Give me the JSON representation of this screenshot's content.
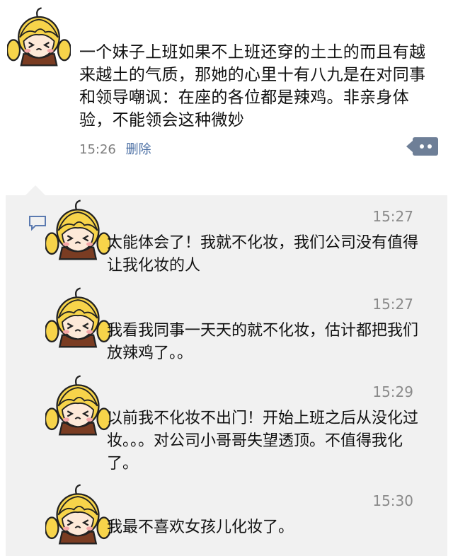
{
  "post": {
    "text": "一个妹子上班如果不上班还穿的土土的而且有越来越土的气质，那她的心里十有八九是在对同事和领导嘲讽：在座的各位都是辣鸡。非亲身体验，不能领会这种微妙",
    "time": "15:26",
    "delete_label": "删除"
  },
  "comments": [
    {
      "time": "15:27",
      "text": "太能体会了！我就不化妆，我们公司没有值得让我化妆的人"
    },
    {
      "time": "15:27",
      "text": "我看我同事一天天的就不化妆，估计都把我们放辣鸡了。。"
    },
    {
      "time": "15:29",
      "text": "以前我不化妆不出门！开始上班之后从没化过妆。。。对公司小哥哥失望透顶。不值得我化了。"
    },
    {
      "time": "15:30",
      "text": "我最不喜欢女孩儿化妆了。"
    }
  ],
  "colors": {
    "link": "#4b6fa4",
    "comment_bg": "#f1f1f1",
    "more_button": "#6e7f97"
  },
  "icons": [
    "avatar-cartoon-girl",
    "more-dots-icon",
    "comment-bubble-icon"
  ]
}
